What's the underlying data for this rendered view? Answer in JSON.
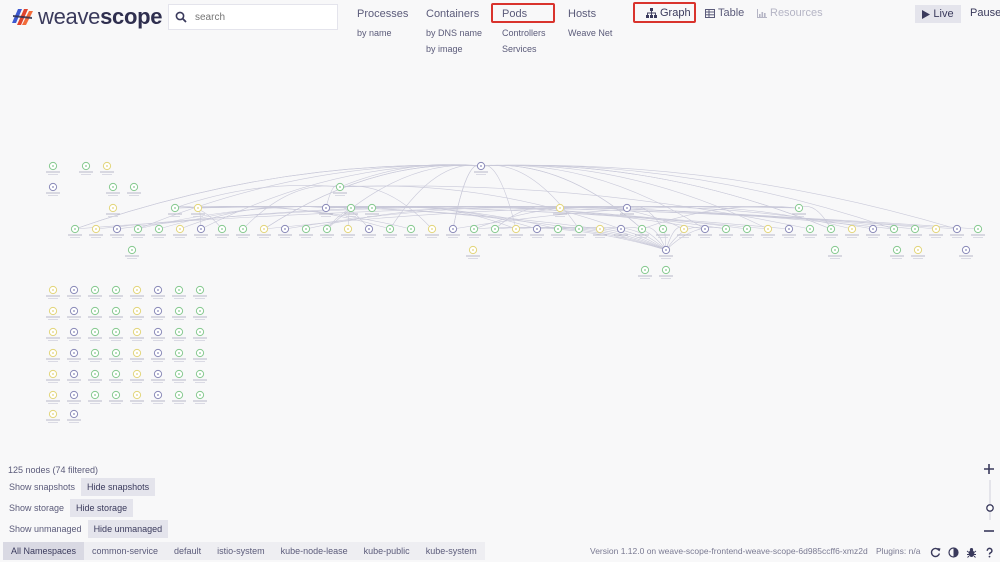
{
  "app": {
    "logo_text_light": "weave",
    "logo_text_bold": "scope",
    "logo_name": "weavescope-logo"
  },
  "search": {
    "placeholder": "search"
  },
  "topologies": [
    {
      "label": "Processes",
      "subs": [
        "by name"
      ]
    },
    {
      "label": "Containers",
      "subs": [
        "by DNS name",
        "by image"
      ]
    },
    {
      "label": "Pods",
      "subs": [
        "Controllers",
        "Services"
      ]
    },
    {
      "label": "Hosts",
      "subs": [
        "Weave Net"
      ]
    }
  ],
  "views": {
    "graph": "Graph",
    "table": "Table",
    "resources": "Resources"
  },
  "controls": {
    "live": "Live",
    "pause": "Pause"
  },
  "status": {
    "nodes": "125 nodes (74 filtered)"
  },
  "options": [
    [
      "Show snapshots",
      "Hide snapshots"
    ],
    [
      "Show storage",
      "Hide storage"
    ],
    [
      "Show unmanaged",
      "Hide unmanaged"
    ]
  ],
  "namespaces": [
    "All Namespaces",
    "common-service",
    "default",
    "istio-system",
    "kube-node-lease",
    "kube-public",
    "kube-system"
  ],
  "footer": {
    "version": "Version 1.12.0 on weave-scope-frontend-weave-scope-6d985ccff6-xmz2d",
    "plugins": "Plugins: n/a"
  },
  "colors": {
    "accent_highlight": "#d9332d",
    "node_green": "#86c98f",
    "node_yellow": "#e2d57a",
    "node_purple": "#8a8ab8",
    "edge": "#c9c9d9"
  },
  "icons": [
    "search-icon",
    "graph-icon",
    "table-icon",
    "resources-icon",
    "play-icon",
    "refresh-icon",
    "contrast-icon",
    "bug-icon",
    "help-icon",
    "zoom-in-icon",
    "zoom-out-icon"
  ]
}
